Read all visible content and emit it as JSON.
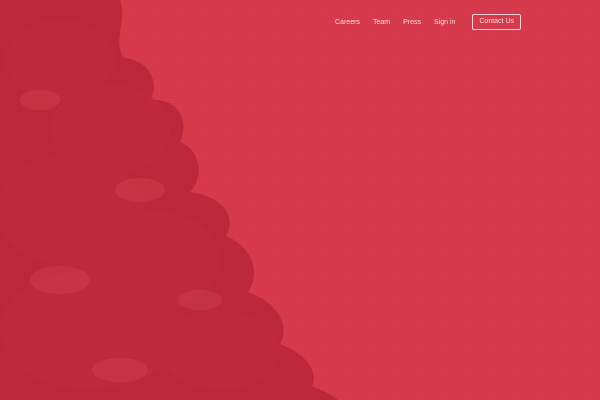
{
  "colors": {
    "background": "#d63a4c",
    "foliage": "#b82438",
    "nav_text": "#f6dde0",
    "button_border": "#f2cfd3"
  },
  "hero": {
    "image_icon": "tree-foliage-image"
  },
  "nav": {
    "links": [
      {
        "label": "Careers"
      },
      {
        "label": "Team"
      },
      {
        "label": "Press"
      },
      {
        "label": "Sign in"
      }
    ],
    "contact_label": "Contact Us"
  }
}
